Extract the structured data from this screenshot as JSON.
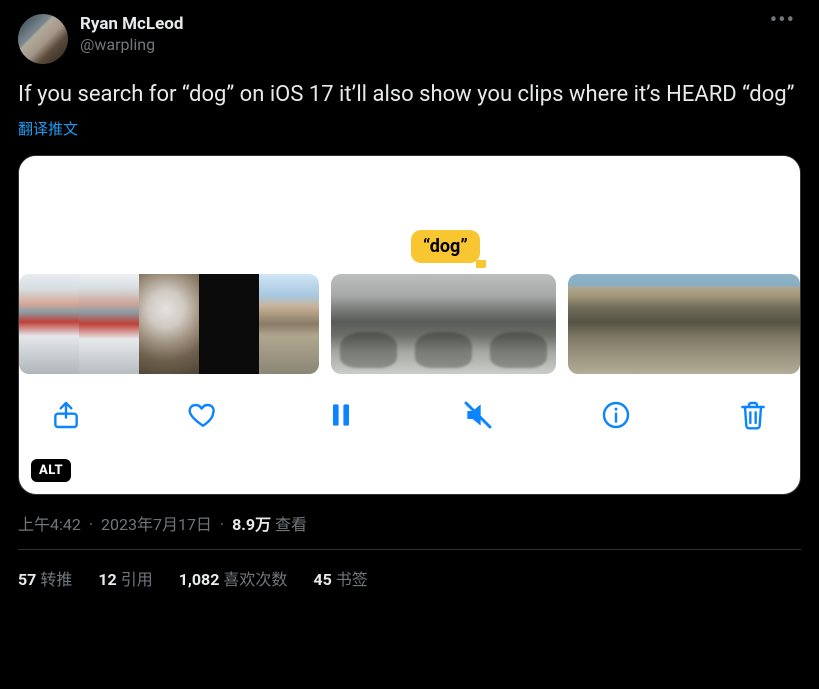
{
  "author": {
    "name": "Ryan McLeod",
    "handle": "@warpling"
  },
  "tweet_text": "If you search for “dog” on iOS 17 it’ll also show you clips where it’s HEARD “dog”",
  "translate_label": "翻译推文",
  "media": {
    "tooltip": "“dog”",
    "alt_badge": "ALT"
  },
  "meta": {
    "time": "上午4:42",
    "date": "2023年7月17日",
    "views_count": "8.9万",
    "views_label": "查看",
    "separator": "·"
  },
  "stats": {
    "retweets": {
      "count": "57",
      "label": "转推"
    },
    "quotes": {
      "count": "12",
      "label": "引用"
    },
    "likes": {
      "count": "1,082",
      "label": "喜欢次数"
    },
    "bookmarks": {
      "count": "45",
      "label": "书签"
    }
  }
}
